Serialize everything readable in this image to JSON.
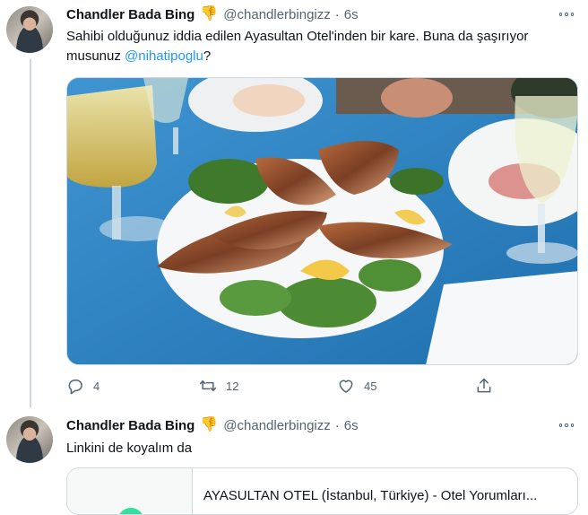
{
  "tweets": [
    {
      "display_name": "Chandler Bada Bing",
      "badge_emoji": "👎",
      "handle": "@chandlerbingizz",
      "separator": "·",
      "time": "6s",
      "text_before": "Sahibi olduğunuz iddia edilen Ayasultan Otel'inden bir kare. Buna da şaşırıyor musunuz ",
      "mention": "@nihatipoglu",
      "text_after": "?",
      "media_description": "plate of grilled shrimp",
      "actions": {
        "reply_count": "4",
        "retweet_count": "12",
        "like_count": "45"
      }
    },
    {
      "display_name": "Chandler Bada Bing",
      "badge_emoji": "👎",
      "handle": "@chandlerbingizz",
      "separator": "·",
      "time": "6s",
      "text": "Linkini de koyalım da",
      "card": {
        "title": "AYASULTAN OTEL (İstanbul, Türkiye) - Otel Yorumları..."
      }
    }
  ],
  "icons": {
    "more": "more-icon",
    "reply": "reply-icon",
    "retweet": "retweet-icon",
    "like": "heart-icon",
    "share": "share-icon"
  },
  "colors": {
    "link": "#1d9bf0",
    "text": "#0f1419",
    "secondary": "#536471",
    "border": "#cfd9de"
  }
}
